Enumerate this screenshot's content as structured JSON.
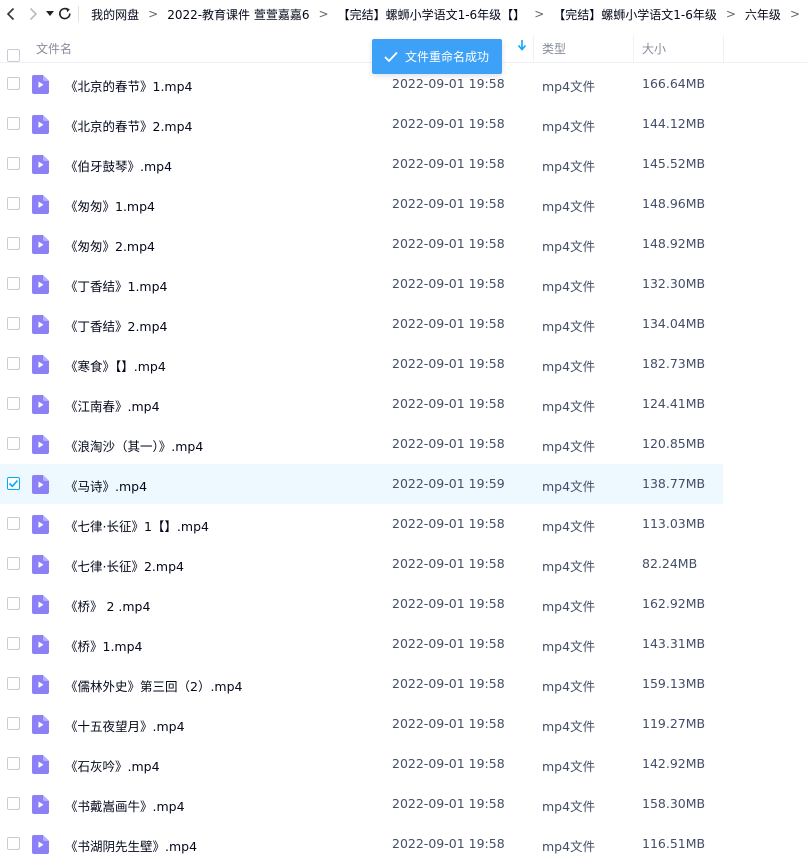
{
  "colors": {
    "accent": "#06a7ff",
    "toast_bg": "#3da2f7",
    "selected_row": "#eef8ff",
    "file_icon": "#8c80f7"
  },
  "nav": {
    "back_icon": "chevron-left-icon",
    "forward_icon": "chevron-right-icon",
    "menu_icon": "caret-down-icon",
    "refresh_icon": "refresh-icon",
    "breadcrumbs": [
      "我的网盘",
      "2022-教育课件 萱萱嘉嘉6",
      "【完结】螺蛳小学语文1-6年级【】",
      "【完结】螺蛳小学语文1-6年级",
      "六年级"
    ],
    "separator": ">"
  },
  "header": {
    "name": "文件名",
    "type": "类型",
    "size": "大小",
    "sort_icon": "sort-arrow-down-icon"
  },
  "toast": {
    "text": "文件重命名成功",
    "icon": "check-icon"
  },
  "files": [
    {
      "name": "《北京的春节》1.mp4",
      "date": "2022-09-01 19:58",
      "type": "mp4文件",
      "size": "166.64MB",
      "selected": false
    },
    {
      "name": "《北京的春节》2.mp4",
      "date": "2022-09-01 19:58",
      "type": "mp4文件",
      "size": "144.12MB",
      "selected": false
    },
    {
      "name": "《伯牙鼓琴》.mp4",
      "date": "2022-09-01 19:58",
      "type": "mp4文件",
      "size": "145.52MB",
      "selected": false
    },
    {
      "name": "《匆匆》1.mp4",
      "date": "2022-09-01 19:58",
      "type": "mp4文件",
      "size": "148.96MB",
      "selected": false
    },
    {
      "name": "《匆匆》2.mp4",
      "date": "2022-09-01 19:58",
      "type": "mp4文件",
      "size": "148.92MB",
      "selected": false
    },
    {
      "name": "《丁香结》1.mp4",
      "date": "2022-09-01 19:58",
      "type": "mp4文件",
      "size": "132.30MB",
      "selected": false
    },
    {
      "name": "《丁香结》2.mp4",
      "date": "2022-09-01 19:58",
      "type": "mp4文件",
      "size": "134.04MB",
      "selected": false
    },
    {
      "name": "《寒食》【】.mp4",
      "date": "2022-09-01 19:58",
      "type": "mp4文件",
      "size": "182.73MB",
      "selected": false
    },
    {
      "name": "《江南春》.mp4",
      "date": "2022-09-01 19:58",
      "type": "mp4文件",
      "size": "124.41MB",
      "selected": false
    },
    {
      "name": "《浪淘沙（其一）》.mp4",
      "date": "2022-09-01 19:58",
      "type": "mp4文件",
      "size": "120.85MB",
      "selected": false
    },
    {
      "name": "《马诗》.mp4",
      "date": "2022-09-01 19:59",
      "type": "mp4文件",
      "size": "138.77MB",
      "selected": true
    },
    {
      "name": "《七律·长征》1【】.mp4",
      "date": "2022-09-01 19:58",
      "type": "mp4文件",
      "size": "113.03MB",
      "selected": false
    },
    {
      "name": "《七律·长征》2.mp4",
      "date": "2022-09-01 19:58",
      "type": "mp4文件",
      "size": "82.24MB",
      "selected": false
    },
    {
      "name": "《桥》 2 .mp4",
      "date": "2022-09-01 19:58",
      "type": "mp4文件",
      "size": "162.92MB",
      "selected": false
    },
    {
      "name": "《桥》1.mp4",
      "date": "2022-09-01 19:58",
      "type": "mp4文件",
      "size": "143.31MB",
      "selected": false
    },
    {
      "name": "《儒林外史》第三回（2）.mp4",
      "date": "2022-09-01 19:58",
      "type": "mp4文件",
      "size": "159.13MB",
      "selected": false
    },
    {
      "name": "《十五夜望月》.mp4",
      "date": "2022-09-01 19:58",
      "type": "mp4文件",
      "size": "119.27MB",
      "selected": false
    },
    {
      "name": "《石灰吟》.mp4",
      "date": "2022-09-01 19:58",
      "type": "mp4文件",
      "size": "142.92MB",
      "selected": false
    },
    {
      "name": "《书戴嵩画牛》.mp4",
      "date": "2022-09-01 19:58",
      "type": "mp4文件",
      "size": "158.30MB",
      "selected": false
    },
    {
      "name": "《书湖阴先生壁》.mp4",
      "date": "2022-09-01 19:58",
      "type": "mp4文件",
      "size": "116.51MB",
      "selected": false
    }
  ]
}
